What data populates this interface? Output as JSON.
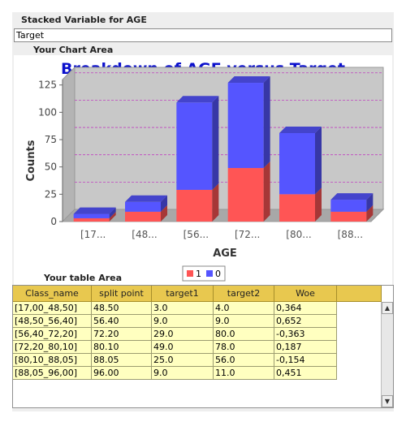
{
  "stacked_variable": {
    "label": "Stacked Variable for AGE",
    "value": "Target"
  },
  "chart_area_label": "Your Chart Area",
  "table_area_label": "Your table Area",
  "colors": {
    "series_1": "#ff5555",
    "series_0": "#5555ff",
    "title": "#0b10cc",
    "header_bg": "#e8c84f",
    "cell_bg": "#ffffc0"
  },
  "chart_data": {
    "type": "bar",
    "stacked": true,
    "title": "Breakdown of AGE versus Target",
    "xlabel": "AGE",
    "ylabel": "Counts",
    "ylim": [
      0,
      130
    ],
    "yticks": [
      0,
      25,
      50,
      75,
      100,
      125
    ],
    "categories": [
      "[17...",
      "[48...",
      "[56...",
      "[72...",
      "[80...",
      "[88..."
    ],
    "series": [
      {
        "name": "1",
        "values": [
          3,
          9,
          29,
          49,
          25,
          9
        ]
      },
      {
        "name": "0",
        "values": [
          4,
          9,
          80,
          78,
          56,
          11
        ]
      }
    ],
    "legend_placement": "bottom-center",
    "grid": true
  },
  "table": {
    "columns": [
      "Class_name",
      "split point",
      "target1",
      "target2",
      "Woe"
    ],
    "rows": [
      [
        "[17,00_48,50]",
        "48.50",
        "3.0",
        "4.0",
        "0,364"
      ],
      [
        "[48,50_56,40]",
        "56.40",
        "9.0",
        "9.0",
        "0,652"
      ],
      [
        "[56,40_72,20]",
        "72.20",
        "29.0",
        "80.0",
        "-0,363"
      ],
      [
        "[72,20_80,10]",
        "80.10",
        "49.0",
        "78.0",
        "0,187"
      ],
      [
        "[80,10_88,05]",
        "88.05",
        "25.0",
        "56.0",
        "-0,154"
      ],
      [
        "[88,05_96,00]",
        "96.00",
        "9.0",
        "11.0",
        "0,451"
      ]
    ]
  },
  "scrollbar": {
    "up_icon": "arrow-up-icon",
    "down_icon": "arrow-down-icon"
  }
}
